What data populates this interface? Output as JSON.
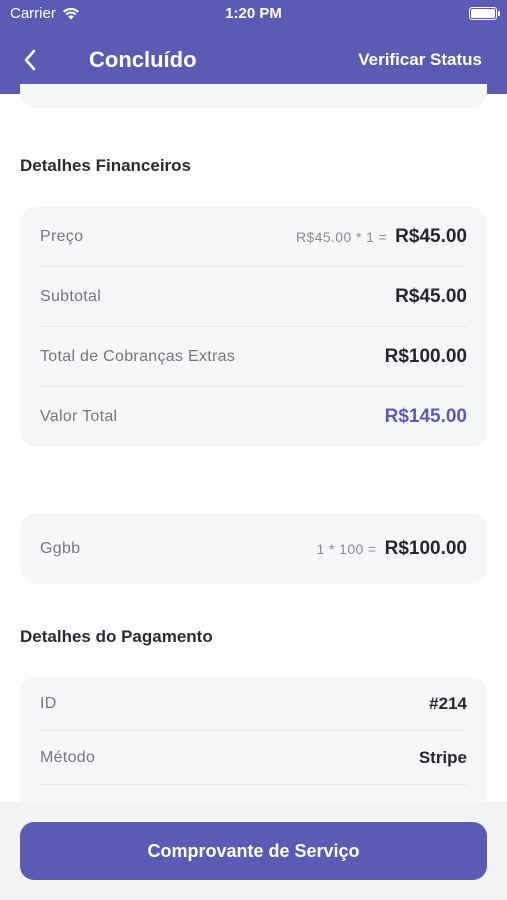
{
  "status_bar": {
    "carrier": "Carrier",
    "time": "1:20 PM"
  },
  "nav": {
    "title": "Concluído",
    "action": "Verificar Status"
  },
  "financial": {
    "title": "Detalhes Financeiros",
    "rows": [
      {
        "label": "Preço",
        "calc": "R$45.00 * 1  =",
        "value": "R$45.00"
      },
      {
        "label": "Subtotal",
        "value": "R$45.00"
      },
      {
        "label": "Total de Cobranças Extras",
        "value": "R$100.00"
      },
      {
        "label": "Valor Total",
        "value": "R$145.00"
      }
    ]
  },
  "extra_charge": {
    "label": "Ggbb",
    "calc": "1 * 100 =",
    "value": "R$100.00"
  },
  "payment": {
    "title": "Detalhes do Pagamento",
    "rows": [
      {
        "label": "ID",
        "value": "#214"
      },
      {
        "label": "Método",
        "value": "Stripe"
      }
    ]
  },
  "cta": {
    "label": "Comprovante de Serviço"
  },
  "colors": {
    "primary": "#5b5bb3",
    "card": "#f6f7f9"
  }
}
